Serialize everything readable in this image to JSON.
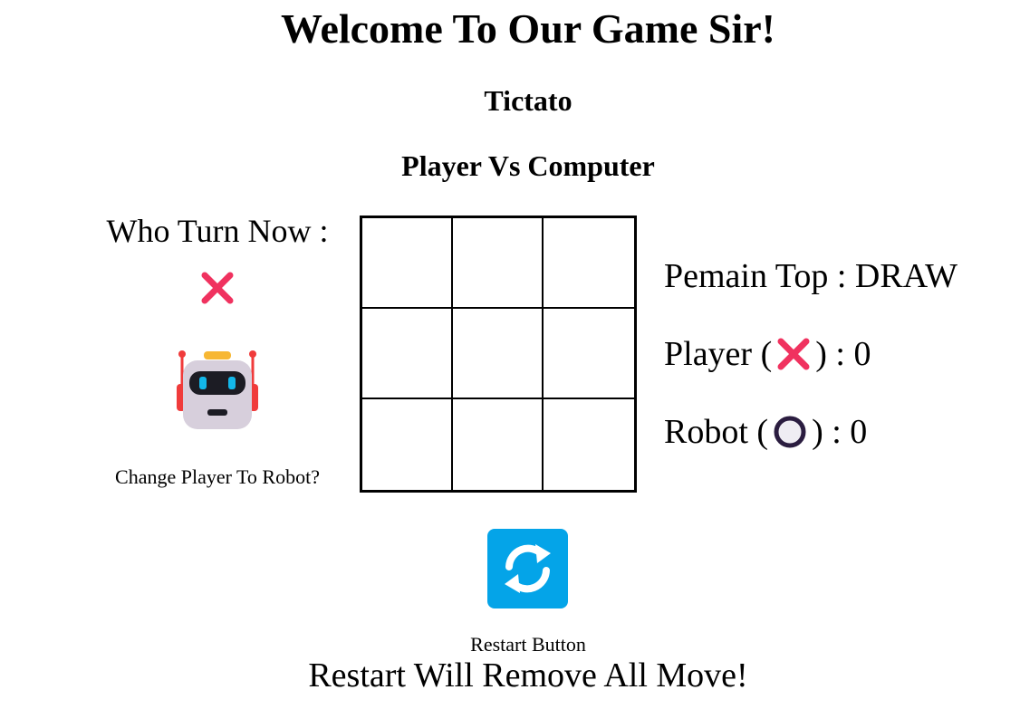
{
  "header": {
    "title": "Welcome To Our Game Sir!",
    "game_name": "Tictato",
    "mode": "Player Vs Computer"
  },
  "left_panel": {
    "turn_label": "Who Turn Now :",
    "current_turn_icon": "cross-icon",
    "robot_icon": "robot-icon",
    "change_player_label": "Change Player To Robot?"
  },
  "board": {
    "cells": [
      "",
      "",
      "",
      "",
      "",
      "",
      "",
      "",
      ""
    ]
  },
  "scoreboard": {
    "top_label": "Pemain Top : DRAW",
    "player_prefix": "Player (",
    "player_suffix": ") : 0",
    "player_icon": "cross-icon",
    "robot_prefix": "Robot (",
    "robot_suffix": ") : 0",
    "robot_icon": "circle-icon"
  },
  "restart": {
    "button_icon": "refresh-icon",
    "button_label": "Restart Button",
    "warning": "Restart Will Remove All Move!"
  },
  "colors": {
    "cross": "#f0325f",
    "circle": "#2b1d40",
    "restart_bg": "#04a4e8"
  }
}
